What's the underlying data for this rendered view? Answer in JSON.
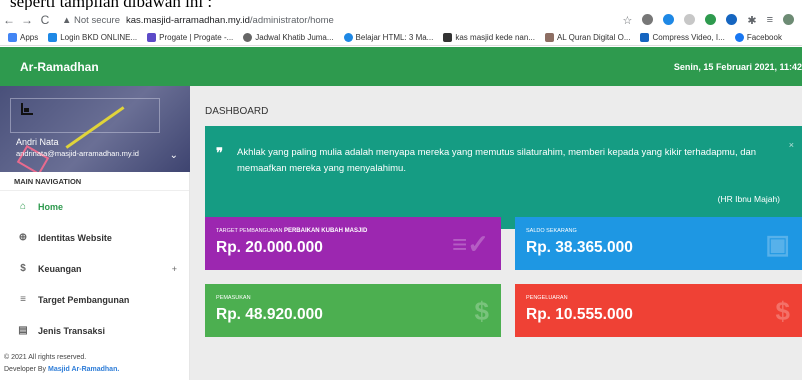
{
  "caption": "seperti tampilan dibawah ini :",
  "browser": {
    "nav_back": "←",
    "nav_forward": "→",
    "nav_reload": "C",
    "secure_label": "▲ Not secure",
    "url_domain": "kas.masjid-arramadhan.my.id",
    "url_path": "/administrator/home"
  },
  "bookmarks": [
    {
      "label": "Apps",
      "icon": "apps-grid-icon",
      "color": "#4285f4"
    },
    {
      "label": "Login BKD ONLINE...",
      "icon": "bkd-icon",
      "color": "#1e88e5"
    },
    {
      "label": "Progate | Progate -...",
      "icon": "progate-icon",
      "color": "#5c4ac7"
    },
    {
      "label": "Jadwal Khatib Juma...",
      "icon": "globe-icon",
      "color": "#666666"
    },
    {
      "label": "Belajar HTML: 3 Ma...",
      "icon": "html-icon",
      "color": "#1e88e5"
    },
    {
      "label": "kas masjid kede nan...",
      "icon": "masjid-icon",
      "color": "#333333"
    },
    {
      "label": "AL Quran Digital O...",
      "icon": "quran-icon",
      "color": "#8d6e63"
    },
    {
      "label": "Compress Video, I...",
      "icon": "compress-icon",
      "color": "#1565c0"
    },
    {
      "label": "Facebook",
      "icon": "facebook-icon",
      "color": "#1877f2"
    }
  ],
  "header": {
    "brand": "Ar-Ramadhan",
    "date": "Senin, 15 Februari 2021, 11:42"
  },
  "user": {
    "name": "Andri Nata",
    "email": "andrinata@masjid-arramadhan.my.id"
  },
  "sidebar": {
    "nav_header": "MAIN NAVIGATION",
    "items": [
      {
        "label": "Home",
        "icon": "home-icon",
        "glyph": "⌂"
      },
      {
        "label": "Identitas Website",
        "icon": "globe-icon",
        "glyph": "⊕"
      },
      {
        "label": "Keuangan",
        "icon": "dollar-icon",
        "glyph": "$"
      },
      {
        "label": "Target Pembangunan",
        "icon": "checklist-icon",
        "glyph": "≡"
      },
      {
        "label": "Jenis Transaksi",
        "icon": "list-icon",
        "glyph": "▤"
      }
    ],
    "expand_glyph": "+",
    "footer_line1": "© 2021 All rights reserved.",
    "footer_prefix": "Developer By",
    "footer_link": "Masjid Ar-Ramadhan."
  },
  "main": {
    "title": "DASHBOARD",
    "quote": {
      "mark": "❞",
      "text": "Akhlak yang paling mulia adalah menyapa mereka yang memutus silaturahim, memberi kepada yang kikir terhadapmu, dan memaafkan mereka yang menyalahimu.",
      "source": "(HR Ibnu Majah)"
    },
    "cards": [
      {
        "label": "TARGET PEMBANGUNAN",
        "label_bold": "Perbaikan Kubah Masjid",
        "value": "Rp. 20.000.000",
        "icon": "checklist-icon",
        "color": "#9c27b0"
      },
      {
        "label": "SALDO SEKARANG",
        "label_bold": "",
        "value": "Rp. 38.365.000",
        "icon": "wallet-icon",
        "color": "#1e97e3"
      },
      {
        "label": "PEMASUKAN",
        "label_bold": "",
        "value": "Rp. 48.920.000",
        "icon": "dollar-icon",
        "color": "#4caf50"
      },
      {
        "label": "PENGELUARAN",
        "label_bold": "",
        "value": "Rp. 10.555.000",
        "icon": "dollar-icon",
        "color": "#ef4135"
      }
    ]
  },
  "colors": {
    "topbar": "#2e9a4e",
    "quote_bg": "#159c83",
    "active_menu": "#2e9a4e"
  }
}
